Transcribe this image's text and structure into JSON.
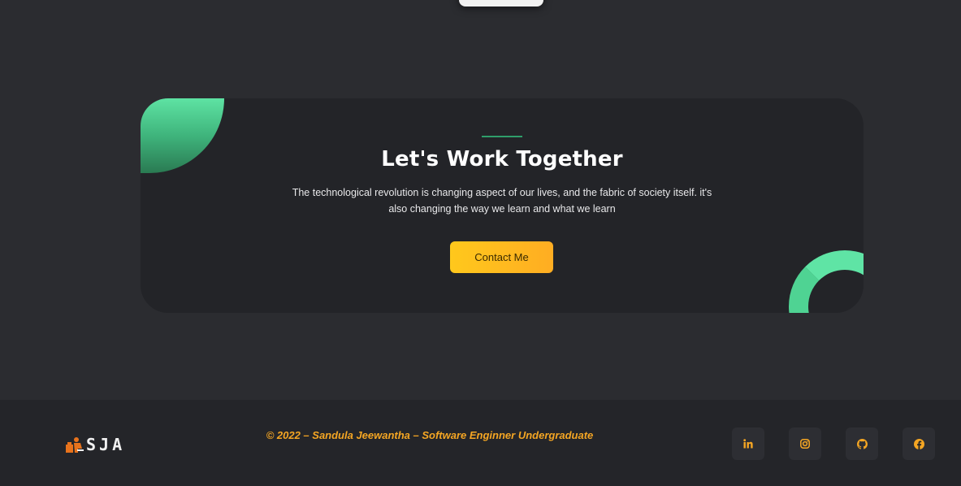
{
  "cta": {
    "title": "Let's Work Together",
    "description": "The technological revolution is changing aspect of our lives, and the fabric of society itself. it's also changing the way we learn and what we learn",
    "button_label": "Contact Me"
  },
  "footer": {
    "logo_text": "SJA",
    "copyright": "© 2022 – Sandula Jeewantha – Software Enginner Undergraduate",
    "social_icons": [
      "linkedin-icon",
      "instagram-icon",
      "github-icon",
      "facebook-icon"
    ]
  },
  "colors": {
    "background": "#2b2c30",
    "card": "#232428",
    "accent_green": "#4fd393",
    "accent_orange": "#f5a623",
    "button_gradient_start": "#ffc81c",
    "button_gradient_end": "#ffad22"
  }
}
